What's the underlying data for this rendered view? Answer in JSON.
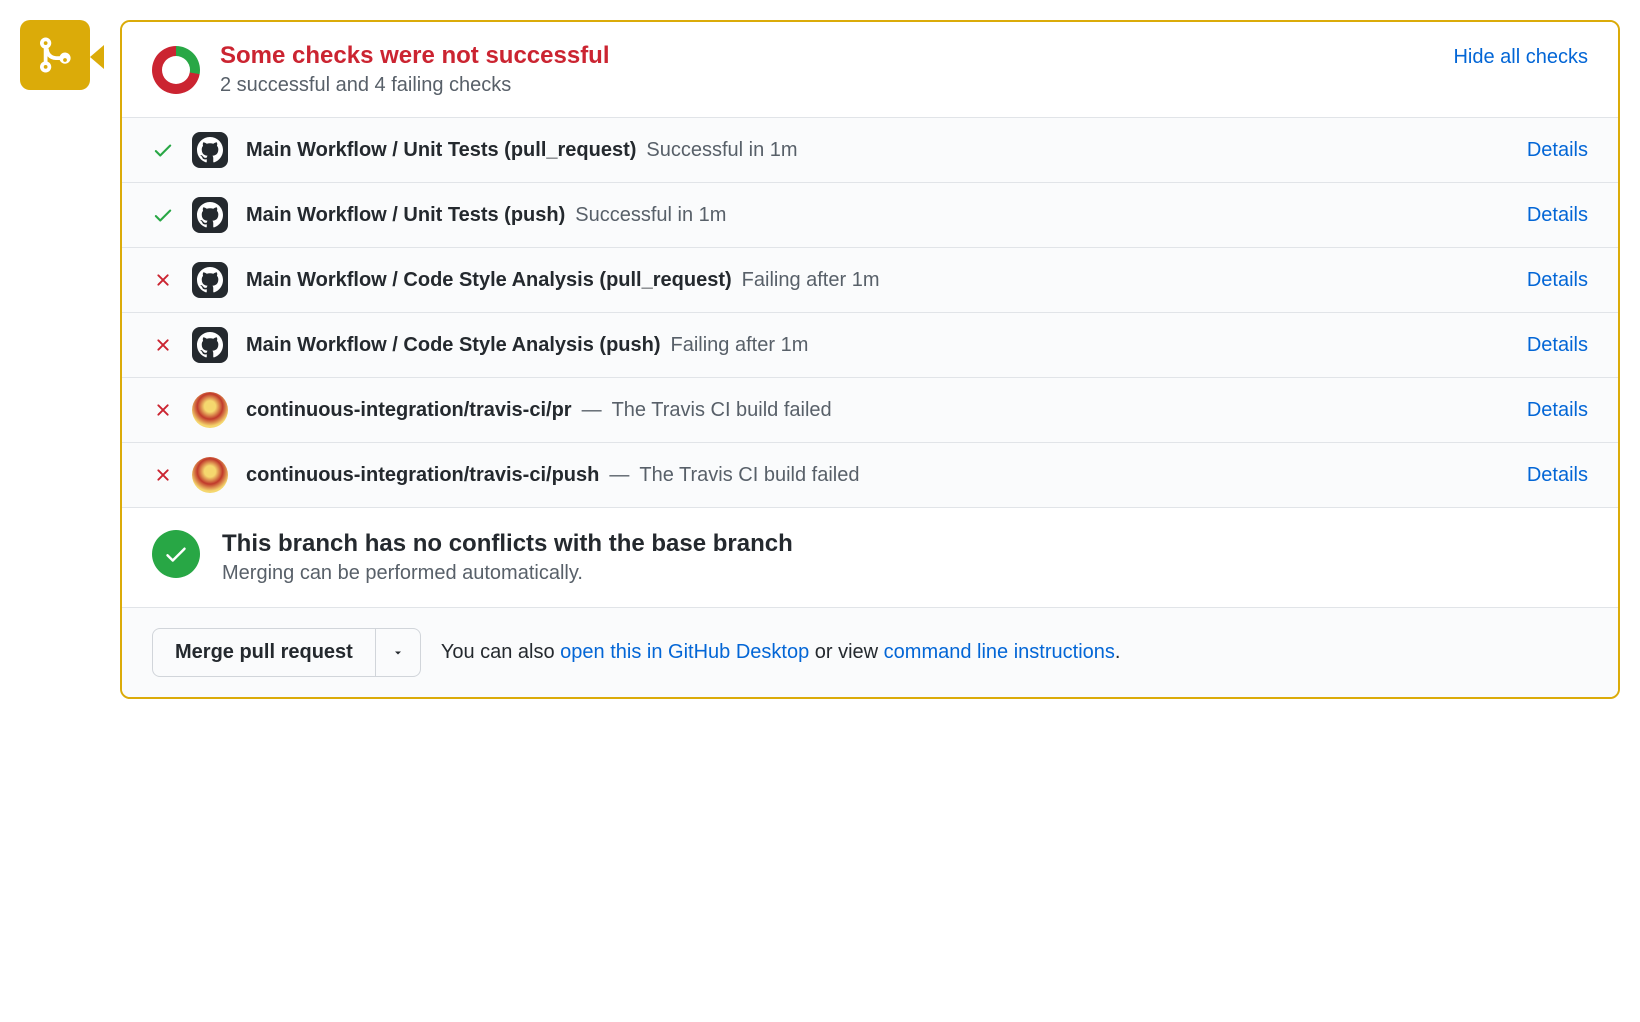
{
  "header": {
    "headline": "Some checks were not successful",
    "subline": "2 successful and 4 failing checks",
    "hide_label": "Hide all checks"
  },
  "checks": [
    {
      "status": "success",
      "avatar": "github",
      "name": "Main Workflow / Unit Tests (pull_request)",
      "dash": false,
      "message": "Successful in 1m",
      "details_label": "Details"
    },
    {
      "status": "success",
      "avatar": "github",
      "name": "Main Workflow / Unit Tests (push)",
      "dash": false,
      "message": "Successful in 1m",
      "details_label": "Details"
    },
    {
      "status": "failure",
      "avatar": "github",
      "name": "Main Workflow / Code Style Analysis (pull_request)",
      "dash": false,
      "message": "Failing after 1m",
      "details_label": "Details"
    },
    {
      "status": "failure",
      "avatar": "github",
      "name": "Main Workflow / Code Style Analysis (push)",
      "dash": false,
      "message": "Failing after 1m",
      "details_label": "Details"
    },
    {
      "status": "failure",
      "avatar": "travis",
      "name": "continuous-integration/travis-ci/pr",
      "dash": true,
      "message": "The Travis CI build failed",
      "details_label": "Details"
    },
    {
      "status": "failure",
      "avatar": "travis",
      "name": "continuous-integration/travis-ci/push",
      "dash": true,
      "message": "The Travis CI build failed",
      "details_label": "Details"
    }
  ],
  "conflicts": {
    "title": "This branch has no conflicts with the base branch",
    "subtitle": "Merging can be performed automatically."
  },
  "merge": {
    "button_label": "Merge pull request",
    "hint_prefix": "You can also ",
    "open_desktop": "open this in GitHub Desktop",
    "hint_middle": " or view ",
    "cmd_instructions": "command line instructions",
    "hint_suffix": "."
  }
}
